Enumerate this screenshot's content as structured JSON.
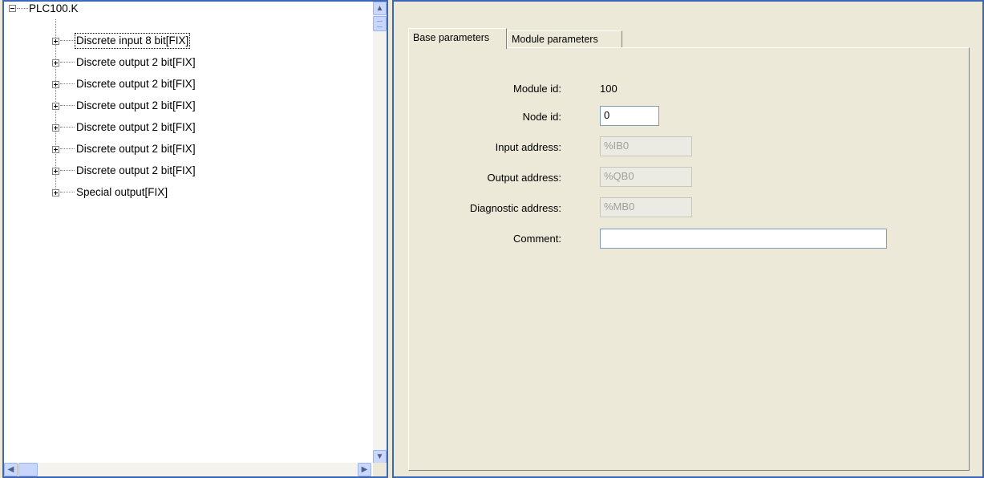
{
  "tree": {
    "root": "PLC100.K",
    "items": [
      {
        "label": "Discrete input 8 bit[FIX]",
        "selected": true
      },
      {
        "label": "Discrete output 2 bit[FIX]"
      },
      {
        "label": "Discrete output 2 bit[FIX]"
      },
      {
        "label": "Discrete output 2 bit[FIX]"
      },
      {
        "label": "Discrete output 2 bit[FIX]"
      },
      {
        "label": "Discrete output 2 bit[FIX]"
      },
      {
        "label": "Discrete output 2 bit[FIX]"
      },
      {
        "label": "Special output[FIX]"
      }
    ]
  },
  "tabs": {
    "base": "Base parameters",
    "module": "Module parameters",
    "active": "base"
  },
  "form": {
    "module_id_label": "Module id:",
    "module_id_value": "100",
    "node_id_label": "Node id:",
    "node_id_value": "0",
    "input_address_label": "Input address:",
    "input_address_value": "%IB0",
    "output_address_label": "Output address:",
    "output_address_value": "%QB0",
    "diagnostic_address_label": "Diagnostic address:",
    "diagnostic_address_value": "%MB0",
    "comment_label": "Comment:",
    "comment_value": ""
  },
  "icons": {
    "collapse": "minus-box-icon",
    "expand": "plus-box-icon",
    "scroll_up": "arrow-up-icon",
    "scroll_down": "arrow-down-icon",
    "scroll_left": "arrow-left-icon",
    "scroll_right": "arrow-right-icon"
  },
  "colors": {
    "pane_border": "#3b67b5",
    "panel_bg": "#ece9d8",
    "disabled_text": "#a0a09a"
  }
}
